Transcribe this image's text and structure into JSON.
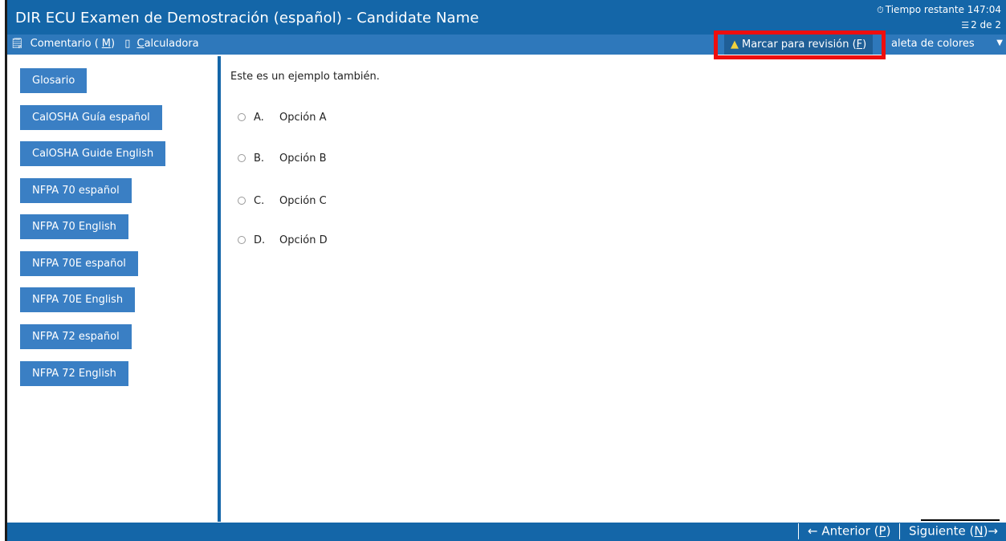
{
  "header": {
    "title": "DIR ECU Examen de Demostración (español) - Candidate Name",
    "timer": "Tiempo restante 147:04",
    "counter": "2 de 2"
  },
  "toolbar": {
    "comment_pre": "Comentario (",
    "comment_key": "M",
    "comment_post": ")",
    "calculator_key": "C",
    "calculator_rest": "alculadora",
    "flag_pre": "Marcar para revisión (",
    "flag_key": "F",
    "flag_post": ")",
    "palette": "aleta de colores"
  },
  "sidebar": {
    "items": [
      "Glosario",
      "CalOSHA Guía español",
      "CalOSHA Guide English",
      "NFPA 70 español",
      "NFPA 70 English",
      "NFPA 70E español",
      "NFPA 70E English",
      "NFPA 72 español",
      "NFPA 72 English"
    ]
  },
  "question": {
    "text": "Este es un ejemplo también.",
    "options": [
      {
        "letter": "A.",
        "text": "Opción A"
      },
      {
        "letter": "B.",
        "text": "Opción B"
      },
      {
        "letter": "C.",
        "text": "Opción C"
      },
      {
        "letter": "D.",
        "text": "Opción D"
      }
    ]
  },
  "nav": {
    "prev_pre": "← Anterior (",
    "prev_key": "P",
    "prev_post": ")",
    "next_pre": "Siguiente (",
    "next_key": "N",
    "next_post": ")→"
  },
  "colors": {
    "header": "#1466a8",
    "toolbar": "#2e78bb",
    "button": "#3a7fc4",
    "highlight": "#ee0e0e"
  }
}
